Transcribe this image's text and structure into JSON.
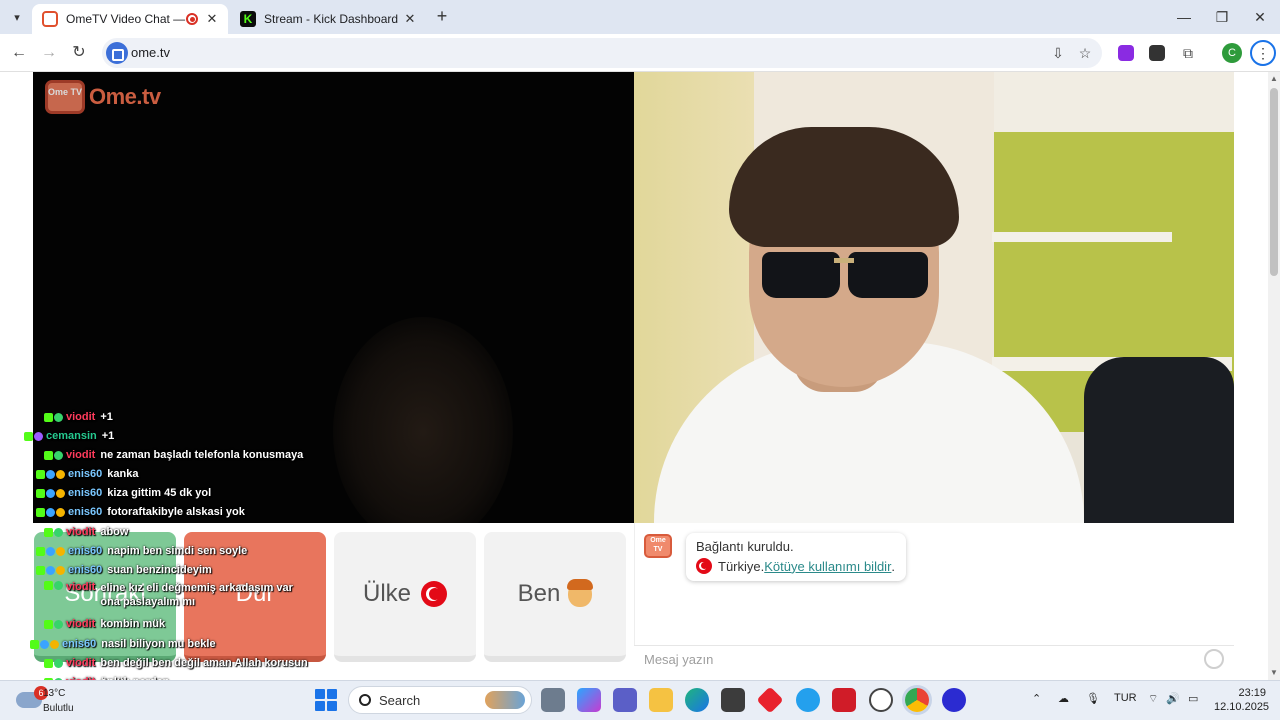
{
  "browser": {
    "tabs": [
      {
        "title": "OmeTV Video Chat — Ome",
        "active": true
      },
      {
        "title": "Stream - Kick Dashboard",
        "active": false
      }
    ],
    "url": "ome.tv",
    "profile_initial": "C"
  },
  "ome": {
    "logo_text": "Ome.tv",
    "logo_small": "Ome TV",
    "buttons": {
      "next": "Sonraki",
      "stop": "Dur",
      "country": "Ülke",
      "me": "Ben"
    },
    "status": {
      "connected": "Bağlantı kuruldu.",
      "country_prefix": "Türkiye. ",
      "report_link": "Kötüye kullanımı bildir",
      "suffix": "."
    },
    "message_placeholder": "Mesaj yazın"
  },
  "stream_chat": [
    {
      "user": "viodit",
      "color": "red",
      "text": "+1",
      "badges": [
        "kick",
        "green"
      ]
    },
    {
      "user": "cemansin",
      "color": "green",
      "text": "+1",
      "badges": [
        "kick",
        "purple"
      ]
    },
    {
      "user": "viodit",
      "color": "red",
      "text": "ne zaman başladı telefonla konusmaya",
      "badges": [
        "kick",
        "green"
      ]
    },
    {
      "user": "enis60",
      "color": "blue",
      "text": "kanka",
      "badges": [
        "kick",
        "blue",
        "gold"
      ]
    },
    {
      "user": "enis60",
      "color": "blue",
      "text": "kiza gittim 45 dk yol",
      "badges": [
        "kick",
        "blue",
        "gold"
      ]
    },
    {
      "user": "enis60",
      "color": "blue",
      "text": "fotoraftakibyle alskasi yok",
      "badges": [
        "kick",
        "blue",
        "gold"
      ]
    },
    {
      "user": "viodit",
      "color": "red",
      "text": "abow",
      "badges": [
        "kick",
        "green"
      ]
    },
    {
      "user": "enis60",
      "color": "blue",
      "text": "napim ben simdi sen soyle",
      "badges": [
        "kick",
        "blue",
        "gold"
      ]
    },
    {
      "user": "enis60",
      "color": "blue",
      "text": "suan benzincideyim",
      "badges": [
        "kick",
        "blue",
        "gold"
      ]
    },
    {
      "user": "viodit",
      "color": "red",
      "text": "eline kız eli değmemiş arkadaşım var ona paslayalım mı",
      "badges": [
        "kick",
        "green"
      ]
    },
    {
      "user": "viodit",
      "color": "red",
      "text": "kombin mük",
      "badges": [
        "kick",
        "green"
      ]
    },
    {
      "user": "enis60",
      "color": "blue",
      "text": "nasil biliyon mu bekle",
      "badges": [
        "kick",
        "blue",
        "gold"
      ]
    },
    {
      "user": "viodit",
      "color": "red",
      "text": "ben değil ben değil aman Allah korusun",
      "badges": [
        "kick",
        "green"
      ]
    },
    {
      "user": "viodit",
      "color": "red",
      "text": "önlük nerden",
      "badges": [
        "kick",
        "green"
      ]
    }
  ],
  "taskbar": {
    "weather_badge": "6",
    "temperature": "13°C",
    "condition": "Bulutlu",
    "search": "Search",
    "language": "TUR",
    "time": "23:19",
    "date": "12.10.2025"
  }
}
